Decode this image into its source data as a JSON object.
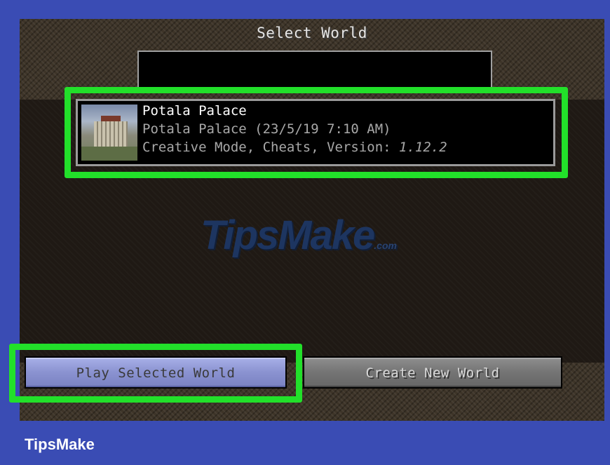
{
  "screen": {
    "title": "Select World"
  },
  "search": {
    "value": ""
  },
  "worlds": [
    {
      "name": "Potala Palace",
      "subtitle": "Potala Palace (23/5/19 7:10 AM)",
      "mode_prefix": "Creative Mode, Cheats, Version: ",
      "version": "1.12.2",
      "thumbnail": "world-thumbnail"
    }
  ],
  "buttons": {
    "play_label": "Play Selected World",
    "create_label": "Create New World"
  },
  "watermark": {
    "text": "TipsMake",
    "suffix": ".com"
  },
  "footer": {
    "brand": "TipsMake"
  },
  "colors": {
    "highlight": "#22e02a",
    "frame": "#3a4cb4",
    "play_button": "#8a92d0",
    "create_button": "#747474"
  }
}
